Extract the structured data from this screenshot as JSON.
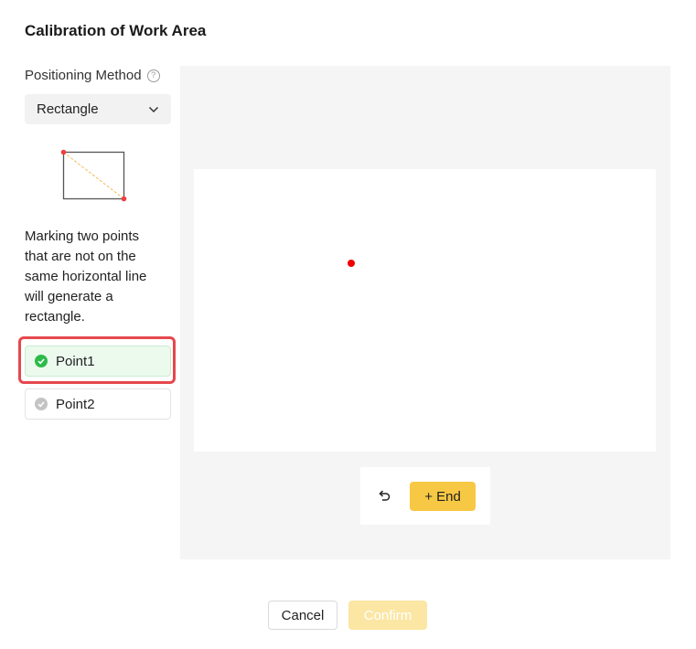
{
  "dialog": {
    "title": "Calibration of Work Area"
  },
  "positioning": {
    "label": "Positioning Method",
    "help_icon": "question-circle-icon",
    "selected_method": "Rectangle",
    "dropdown_icon": "chevron-down-icon",
    "description": "Marking two points that are not on the same horizontal line will generate a rectangle."
  },
  "points": [
    {
      "label": "Point1",
      "status": "completed",
      "icon": "check-circle-icon",
      "status_color": "#2cbb4a"
    },
    {
      "label": "Point2",
      "status": "pending",
      "icon": "check-circle-icon",
      "status_color": "#c4c4c4"
    }
  ],
  "canvas": {
    "marker_color": "#f00000"
  },
  "tools": {
    "undo_icon": "undo-icon",
    "end_label": "+ End"
  },
  "footer": {
    "cancel_label": "Cancel",
    "confirm_label": "Confirm",
    "confirm_enabled": false
  },
  "colors": {
    "accent": "#f7c843",
    "accent_disabled": "#fbe6a3",
    "highlight_border": "#e5484d",
    "success": "#2cbb4a"
  }
}
